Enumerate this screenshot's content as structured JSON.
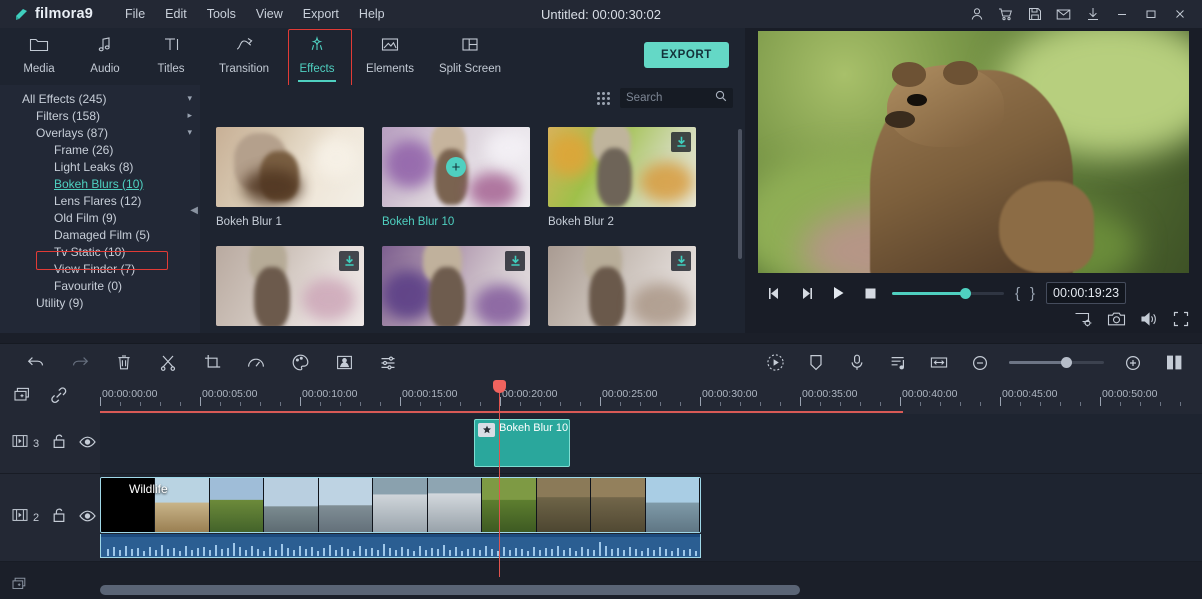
{
  "app": {
    "brand": "filmora9",
    "project_title": "Untitled: 00:00:30:02"
  },
  "menubar": {
    "items": [
      {
        "label": "File"
      },
      {
        "label": "Edit"
      },
      {
        "label": "Tools"
      },
      {
        "label": "View"
      },
      {
        "label": "Export"
      },
      {
        "label": "Help"
      }
    ]
  },
  "window_controls": [
    {
      "name": "account-icon"
    },
    {
      "name": "cart-icon"
    },
    {
      "name": "save-icon"
    },
    {
      "name": "mail-icon"
    },
    {
      "name": "download-icon"
    },
    {
      "name": "minimize-icon"
    },
    {
      "name": "maximize-icon"
    },
    {
      "name": "close-icon"
    }
  ],
  "tabs": {
    "items": [
      {
        "label": "Media",
        "icon": "folder-icon",
        "active": false
      },
      {
        "label": "Audio",
        "icon": "music-note-icon",
        "active": false
      },
      {
        "label": "Titles",
        "icon": "text-icon",
        "active": false
      },
      {
        "label": "Transition",
        "icon": "transition-arrow-icon",
        "active": false
      },
      {
        "label": "Effects",
        "icon": "effects-star-icon",
        "active": true
      },
      {
        "label": "Elements",
        "icon": "image-icon",
        "active": false
      },
      {
        "label": "Split Screen",
        "icon": "split-screen-icon",
        "active": false
      }
    ],
    "export_label": "EXPORT",
    "highlight_color": "#e13b36",
    "accent_color": "#4fd0c0"
  },
  "sidebar": {
    "items": [
      {
        "label": "All Effects (245)",
        "level": 0,
        "chevron": "down",
        "selected": false
      },
      {
        "label": "Filters (158)",
        "level": 1,
        "chevron": "right",
        "selected": false
      },
      {
        "label": "Overlays (87)",
        "level": 1,
        "chevron": "down",
        "selected": false
      },
      {
        "label": "Frame (26)",
        "level": 2,
        "chevron": "",
        "selected": false
      },
      {
        "label": "Light Leaks (8)",
        "level": 2,
        "chevron": "",
        "selected": false
      },
      {
        "label": "Bokeh Blurs (10)",
        "level": 2,
        "chevron": "",
        "selected": true
      },
      {
        "label": "Lens Flares (12)",
        "level": 2,
        "chevron": "",
        "selected": false
      },
      {
        "label": "Old Film (9)",
        "level": 2,
        "chevron": "",
        "selected": false
      },
      {
        "label": "Damaged Film (5)",
        "level": 2,
        "chevron": "",
        "selected": false
      },
      {
        "label": "Tv Static (10)",
        "level": 2,
        "chevron": "",
        "selected": false
      },
      {
        "label": "View Finder (7)",
        "level": 2,
        "chevron": "",
        "selected": false
      },
      {
        "label": "Favourite (0)",
        "level": 2,
        "chevron": "",
        "selected": false
      },
      {
        "label": "Utility (9)",
        "level": 1,
        "chevron": "",
        "selected": false
      }
    ]
  },
  "browser": {
    "search": {
      "placeholder": "Search",
      "value": ""
    },
    "effects": [
      {
        "name": "Bokeh Blur 1",
        "selected": false,
        "downloadable": false
      },
      {
        "name": "Bokeh Blur 10",
        "selected": true,
        "downloadable": false
      },
      {
        "name": "Bokeh Blur 2",
        "selected": false,
        "downloadable": true
      },
      {
        "name": "",
        "selected": false,
        "downloadable": true
      },
      {
        "name": "",
        "selected": false,
        "downloadable": true
      },
      {
        "name": "",
        "selected": false,
        "downloadable": true
      }
    ]
  },
  "preview": {
    "timecode": "00:00:19:23",
    "progress_percent": 62,
    "controls": [
      {
        "name": "previous-frame-button"
      },
      {
        "name": "next-frame-button"
      },
      {
        "name": "play-button"
      },
      {
        "name": "stop-button"
      }
    ],
    "mark_in": "{",
    "mark_out": "}",
    "tools": [
      {
        "name": "display-settings-icon"
      },
      {
        "name": "snapshot-icon"
      },
      {
        "name": "volume-icon"
      },
      {
        "name": "fullscreen-icon"
      }
    ]
  },
  "edit_toolbar": {
    "left": [
      {
        "name": "undo-button"
      },
      {
        "name": "redo-button"
      },
      {
        "name": "delete-button"
      },
      {
        "name": "split-button"
      },
      {
        "name": "crop-button"
      },
      {
        "name": "speed-button"
      },
      {
        "name": "color-button"
      },
      {
        "name": "green-screen-button"
      },
      {
        "name": "adjust-button"
      }
    ],
    "right": [
      {
        "name": "record-playback-button"
      },
      {
        "name": "marker-button"
      },
      {
        "name": "voiceover-button"
      },
      {
        "name": "detach-audio-button"
      },
      {
        "name": "fit-timeline-button"
      },
      {
        "name": "zoom-out-button"
      },
      {
        "name": "zoom-in-button"
      },
      {
        "name": "split-view-button"
      }
    ],
    "zoom_percent": 55
  },
  "timeline": {
    "ruler_labels": [
      "00:00:00:00",
      "00:00:05:00",
      "00:00:10:00",
      "00:00:15:00",
      "00:00:20:00",
      "00:00:25:00",
      "00:00:30:00",
      "00:00:35:00",
      "00:00:40:00",
      "00:00:45:00",
      "00:00:50:00"
    ],
    "playhead_time": "00:00:19:23",
    "tracks": [
      {
        "number": "3",
        "locked": false,
        "visible": true
      },
      {
        "number": "2",
        "locked": false,
        "visible": true
      }
    ],
    "clips": {
      "effect_clip": {
        "label": "Bokeh Blur 10"
      },
      "video_clip": {
        "label": "Wildlife"
      }
    },
    "header_tools": [
      {
        "name": "add-track-icon"
      },
      {
        "name": "link-icon"
      }
    ]
  }
}
